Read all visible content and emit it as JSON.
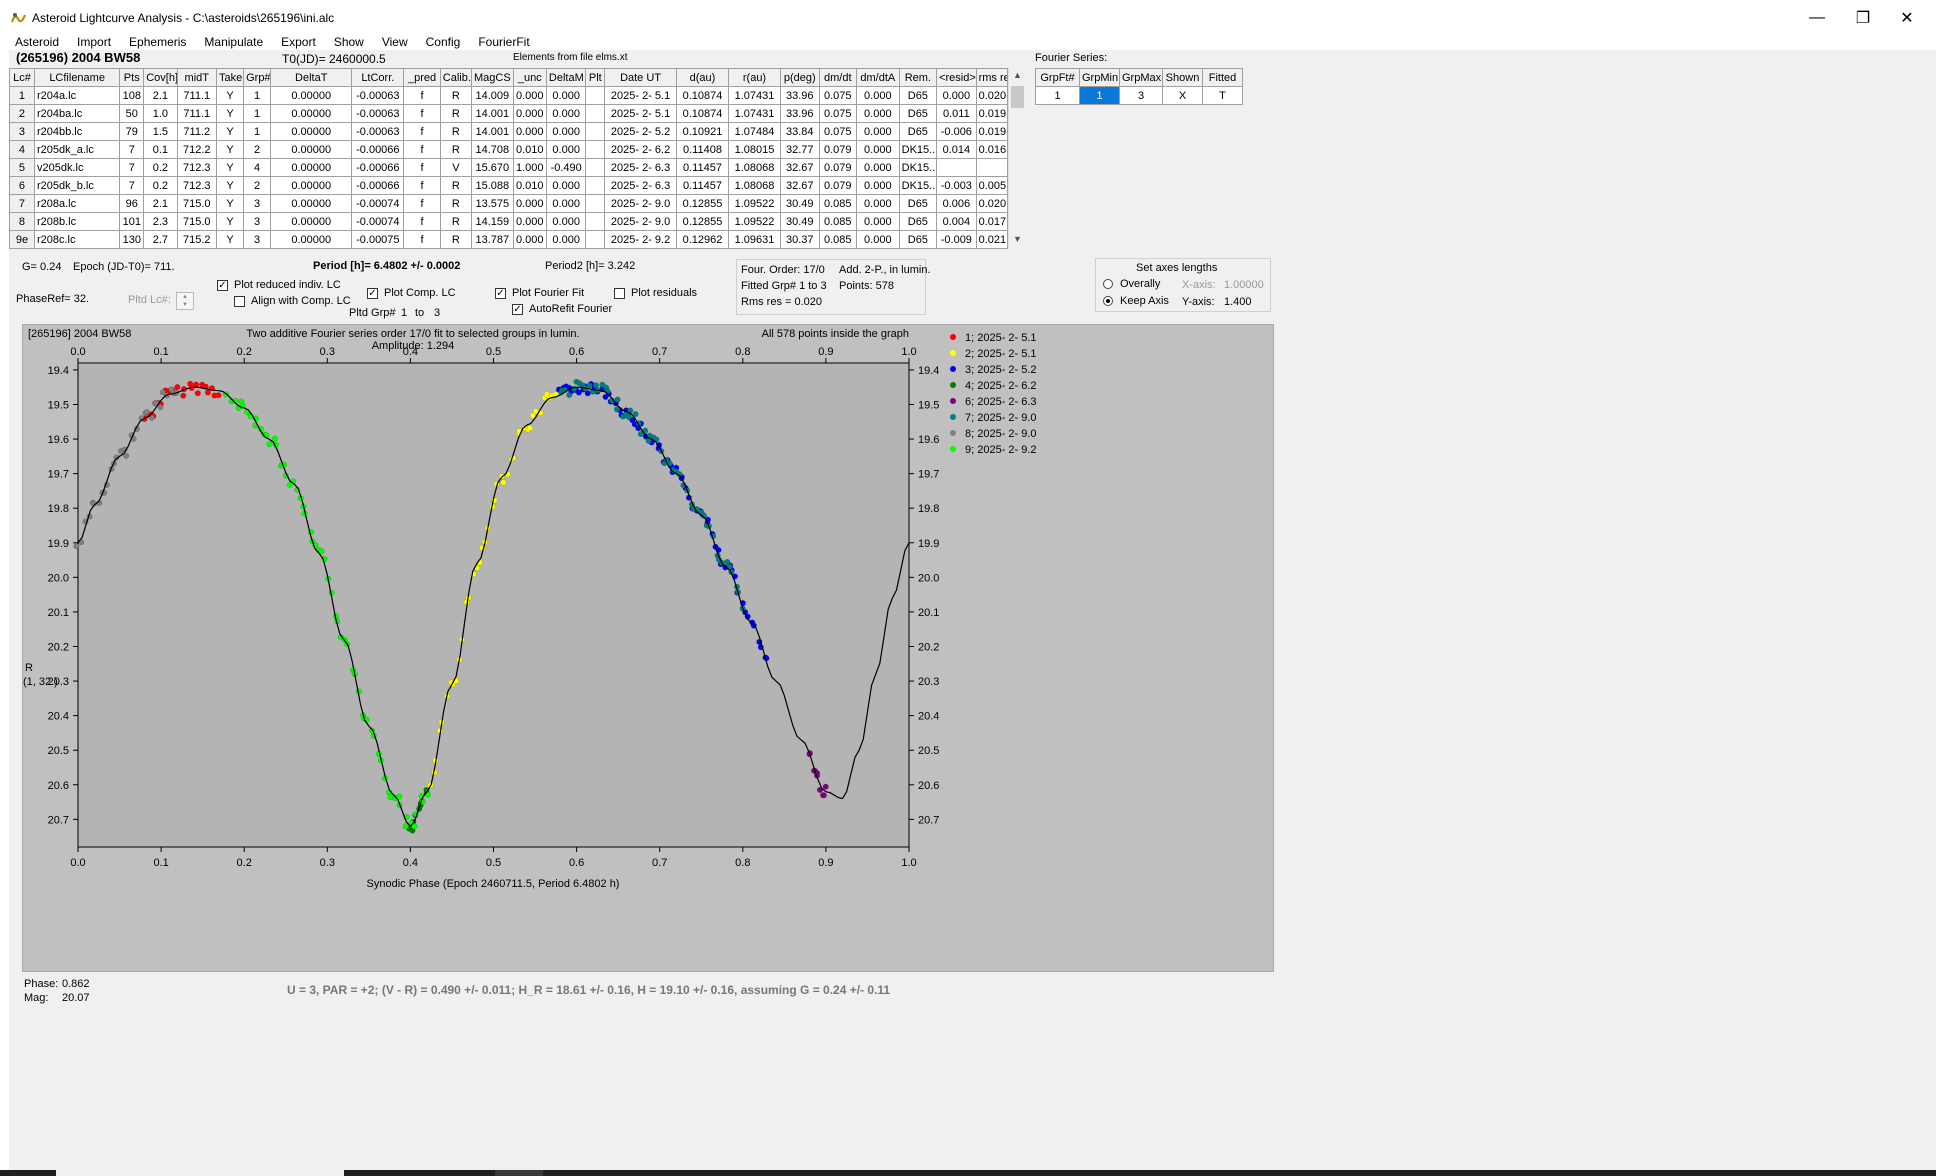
{
  "window": {
    "title": "Asteroid Lightcurve Analysis - C:\\asteroids\\265196\\ini.alc",
    "minimize": "—",
    "restore": "❐",
    "close": "✕"
  },
  "menu": [
    "Asteroid",
    "Import",
    "Ephemeris",
    "Manipulate",
    "Export",
    "Show",
    "View",
    "Config",
    "FourierFit"
  ],
  "header": {
    "asteroid": "(265196) 2004 BW58",
    "t0": "T0(JD)= 2460000.5",
    "elements": "Elements from file elms.xt"
  },
  "lc_table": {
    "columns": [
      "Lc#",
      "LCfilename",
      "Pts",
      "Cov[h]",
      "midT",
      "Take",
      "Grp#",
      "DeltaT",
      "LtCorr.",
      "_pred",
      "Calib.",
      "MagCS",
      "_unc",
      "DeltaM",
      "Plt",
      "Date UT",
      "d(au)",
      "r(au)",
      "p(deg)",
      "dm/dt",
      "dm/dtA",
      "Rem.",
      "<resid>",
      "rms res"
    ],
    "rows": [
      [
        "1",
        "r204a.lc",
        "108",
        "2.1",
        "711.1",
        "Y",
        "1",
        "0.00000",
        "-0.00063",
        "f",
        "R",
        "14.009",
        "0.000",
        "0.000",
        "",
        "2025- 2- 5.1",
        "0.10874",
        "1.07431",
        "33.96",
        "0.075",
        "0.000",
        "D65",
        "0.000",
        "0.020"
      ],
      [
        "2",
        "r204ba.lc",
        "50",
        "1.0",
        "711.1",
        "Y",
        "1",
        "0.00000",
        "-0.00063",
        "f",
        "R",
        "14.001",
        "0.000",
        "0.000",
        "",
        "2025- 2- 5.1",
        "0.10874",
        "1.07431",
        "33.96",
        "0.075",
        "0.000",
        "D65",
        "0.011",
        "0.019"
      ],
      [
        "3",
        "r204bb.lc",
        "79",
        "1.5",
        "711.2",
        "Y",
        "1",
        "0.00000",
        "-0.00063",
        "f",
        "R",
        "14.001",
        "0.000",
        "0.000",
        "",
        "2025- 2- 5.2",
        "0.10921",
        "1.07484",
        "33.84",
        "0.075",
        "0.000",
        "D65",
        "-0.006",
        "0.019"
      ],
      [
        "4",
        "r205dk_a.lc",
        "7",
        "0.1",
        "712.2",
        "Y",
        "2",
        "0.00000",
        "-0.00066",
        "f",
        "R",
        "14.708",
        "0.010",
        "0.000",
        "",
        "2025- 2- 6.2",
        "0.11408",
        "1.08015",
        "32.77",
        "0.079",
        "0.000",
        "DK15..",
        "0.014",
        "0.016"
      ],
      [
        "5",
        "v205dk.lc",
        "7",
        "0.2",
        "712.3",
        "Y",
        "4",
        "0.00000",
        "-0.00066",
        "f",
        "V",
        "15.670",
        "1.000",
        "-0.490",
        "",
        "2025- 2- 6.3",
        "0.11457",
        "1.08068",
        "32.67",
        "0.079",
        "0.000",
        "DK15..",
        "",
        ""
      ],
      [
        "6",
        "r205dk_b.lc",
        "7",
        "0.2",
        "712.3",
        "Y",
        "2",
        "0.00000",
        "-0.00066",
        "f",
        "R",
        "15.088",
        "0.010",
        "0.000",
        "",
        "2025- 2- 6.3",
        "0.11457",
        "1.08068",
        "32.67",
        "0.079",
        "0.000",
        "DK15..",
        "-0.003",
        "0.005"
      ],
      [
        "7",
        "r208a.lc",
        "96",
        "2.1",
        "715.0",
        "Y",
        "3",
        "0.00000",
        "-0.00074",
        "f",
        "R",
        "13.575",
        "0.000",
        "0.000",
        "",
        "2025- 2- 9.0",
        "0.12855",
        "1.09522",
        "30.49",
        "0.085",
        "0.000",
        "D65",
        "0.006",
        "0.020"
      ],
      [
        "8",
        "r208b.lc",
        "101",
        "2.3",
        "715.0",
        "Y",
        "3",
        "0.00000",
        "-0.00074",
        "f",
        "R",
        "14.159",
        "0.000",
        "0.000",
        "",
        "2025- 2- 9.0",
        "0.12855",
        "1.09522",
        "30.49",
        "0.085",
        "0.000",
        "D65",
        "0.004",
        "0.017"
      ],
      [
        "9e",
        "r208c.lc",
        "130",
        "2.7",
        "715.2",
        "Y",
        "3",
        "0.00000",
        "-0.00075",
        "f",
        "R",
        "13.787",
        "0.000",
        "0.000",
        "",
        "2025- 2- 9.2",
        "0.12962",
        "1.09631",
        "30.37",
        "0.085",
        "0.000",
        "D65",
        "-0.009",
        "0.021"
      ]
    ]
  },
  "fourier_panel": {
    "title": "Fourier Series:",
    "columns": [
      "GrpFt#",
      "GrpMin",
      "GrpMax",
      "Shown",
      "Fitted"
    ],
    "row": [
      "1",
      "1",
      "3",
      "X",
      "T"
    ]
  },
  "controls": {
    "g_label": "G= 0.24",
    "epoch_label": "Epoch (JD-T0)= 711.",
    "period": "Period [h]= 6.4802 +/- 0.0002",
    "period2": "Period2 [h]= 3.242",
    "phaseref": "PhaseRef= 32.",
    "pltd_lc": "Pltd Lc#:",
    "plot_reduced": "Plot reduced indiv. LC",
    "align_comp": "Align with Comp. LC",
    "plot_comp": "Plot Comp. LC",
    "pltd_grp": "Pltd Grp#",
    "grp_from": "1",
    "grp_to_word": "to",
    "grp_to": "3",
    "plot_fourier": "Plot Fourier Fit",
    "autorefit": "AutoRefit Fourier",
    "plot_residuals": "Plot residuals",
    "checked_mark": "✓"
  },
  "fit_info": {
    "four_order": "Four. Order: 17/0",
    "add": "Add. 2-P., in lumin.",
    "fitted_grp": "Fitted Grp# 1 to 3",
    "points": "Points: 578",
    "rms": "Rms res      = 0.020"
  },
  "axes_box": {
    "title": "Set axes lengths",
    "overally": "Overally",
    "keep_axis": "Keep Axis",
    "xaxis_label": "X-axis:",
    "xaxis_val": "1.00000",
    "yaxis_label": "Y-axis:",
    "yaxis_val": "1.400"
  },
  "chart_data": {
    "type": "scatter",
    "title_left": "[265196] 2004 BW58",
    "title_center": "Two additive Fourier series order 17/0 fit to selected groups in lumin.",
    "amplitude": "Amplitude: 1.294",
    "title_right": "All 578 points inside the graph",
    "xlabel": "Synodic Phase (Epoch 2460711.5, Period 6.4802 h)",
    "ylabel": "R",
    "ylabel2": "(1, 32.)",
    "xlim": [
      0.0,
      1.0
    ],
    "ylim": [
      20.78,
      19.38
    ],
    "x_ticks": [
      "0.0",
      "0.1",
      "0.2",
      "0.3",
      "0.4",
      "0.5",
      "0.6",
      "0.7",
      "0.8",
      "0.9",
      "1.0"
    ],
    "y_ticks": [
      "19.4",
      "19.5",
      "19.6",
      "19.7",
      "19.8",
      "19.9",
      "20.0",
      "20.1",
      "20.2",
      "20.3",
      "20.4",
      "20.5",
      "20.6",
      "20.7"
    ],
    "legend": "right",
    "series": [
      {
        "name": "1; 2025- 2- 5.1",
        "color": "#ff0000",
        "phases": [
          0.08,
          0.17
        ]
      },
      {
        "name": "2; 2025- 2- 5.1",
        "color": "#ffff00",
        "phases": [
          0.42,
          0.58
        ]
      },
      {
        "name": "3; 2025- 2- 5.2",
        "color": "#0000ff",
        "phases": [
          0.58,
          0.83
        ]
      },
      {
        "name": "4; 2025- 2- 6.2",
        "color": "#008000",
        "phases": [
          0.4,
          0.42
        ]
      },
      {
        "name": "6; 2025- 2- 6.3",
        "color": "#800080",
        "phases": [
          0.88,
          0.9
        ]
      },
      {
        "name": "7; 2025- 2- 9.0",
        "color": "#008080",
        "phases": [
          0.58,
          0.8
        ]
      },
      {
        "name": "8; 2025- 2- 9.0",
        "color": "#808080",
        "phases": [
          0.0,
          0.12
        ]
      },
      {
        "name": "9; 2025- 2- 9.2",
        "color": "#00ff00",
        "phases": [
          0.18,
          0.42
        ]
      }
    ],
    "fit_curve": {
      "phase": [
        0.0,
        0.02,
        0.05,
        0.08,
        0.11,
        0.14,
        0.17,
        0.2,
        0.23,
        0.26,
        0.29,
        0.32,
        0.35,
        0.38,
        0.4,
        0.42,
        0.45,
        0.48,
        0.51,
        0.54,
        0.57,
        0.6,
        0.63,
        0.66,
        0.69,
        0.72,
        0.75,
        0.78,
        0.81,
        0.84,
        0.87,
        0.9,
        0.92,
        0.94,
        0.96,
        0.98,
        1.0
      ],
      "mag": [
        19.9,
        19.79,
        19.65,
        19.54,
        19.47,
        19.45,
        19.46,
        19.51,
        19.6,
        19.73,
        19.93,
        20.18,
        20.43,
        20.63,
        20.72,
        20.62,
        20.31,
        19.96,
        19.71,
        19.56,
        19.48,
        19.45,
        19.46,
        19.52,
        19.6,
        19.7,
        19.82,
        19.97,
        20.13,
        20.3,
        20.47,
        20.62,
        20.64,
        20.5,
        20.28,
        20.06,
        19.9
      ]
    }
  },
  "cursor_readout": {
    "phase_label": "Phase:",
    "phase": "0.862",
    "mag_label": "Mag:",
    "mag": "20.07"
  },
  "summary": "U = 3, PAR = +2; (V - R) = 0.490 +/- 0.011; H_R = 18.61 +/- 0.16, H = 19.10 +/- 0.16, assuming G = 0.24 +/- 0.11"
}
